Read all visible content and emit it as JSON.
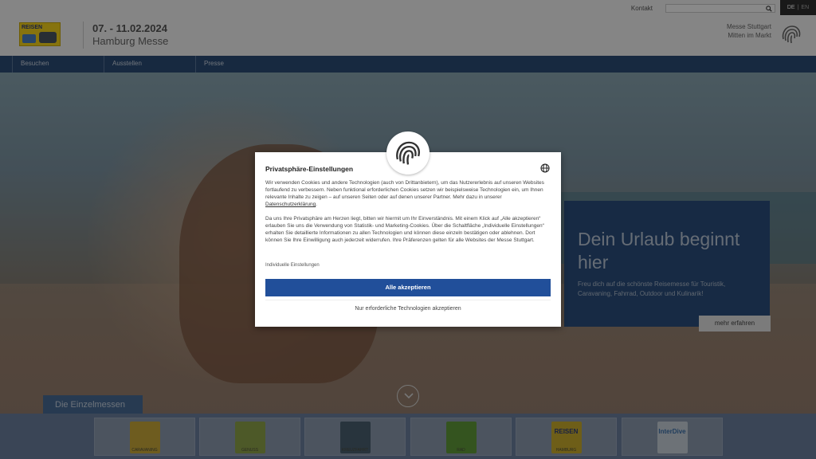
{
  "header": {
    "contact_label": "Kontakt",
    "search_placeholder": "",
    "lang_active": "DE",
    "lang_sep": "|",
    "lang_other": "EN",
    "event_date": "07. - 11.02.2024",
    "event_place": "Hamburg Messe",
    "brand_line1": "Messe Stuttgart",
    "brand_line2": "Mitten im Markt",
    "logo_word": "REISEN"
  },
  "nav": {
    "items": [
      {
        "label": "Besuchen"
      },
      {
        "label": "Ausstellen"
      },
      {
        "label": "Presse"
      }
    ]
  },
  "promo": {
    "title": "Dein Urlaub beginnt hier",
    "text": "Freu dich auf die schönste Reisemesse für Touristik, Caravaning, Fahrrad, Outdoor und Kulinarik!",
    "button": "mehr erfahren"
  },
  "einzelmessen": {
    "tab_label": "Die Einzelmessen",
    "cards": [
      {
        "word": "",
        "label": "CARAVANING",
        "color": "#c8a83a"
      },
      {
        "word": "",
        "label": "GENUSS",
        "color": "#8da34a"
      },
      {
        "word": "",
        "label": "KREUZFAHRT",
        "color": "#4a6070"
      },
      {
        "word": "",
        "label": "RAD",
        "color": "#5f9a3a"
      },
      {
        "word": "REISEN",
        "label": "HAMBURG",
        "color": "#c8ac2c"
      },
      {
        "word": "InterDive",
        "label": "",
        "color": "#c6cfd9"
      }
    ]
  },
  "modal": {
    "title": "Privatsphäre-Einstellungen",
    "p1": "Wir verwenden Cookies und andere Technologien (auch von Drittanbietern), um das Nutzererlebnis auf unseren Websites fortlaufend zu verbessern. Neben funktional erforderlichen Cookies setzen wir beispielsweise Technologien ein, um Ihnen relevante Inhalte zu zeigen – auf unseren Seiten oder auf denen unserer Partner. Mehr dazu in unserer ",
    "p1_link": "Datenschutzerklärung",
    "p1_end": ".",
    "p2": "Da uns Ihre Privatsphäre am Herzen liegt, bitten wir hiermit um Ihr Einverständnis. Mit einem Klick auf „Alle akzeptieren“ erlauben Sie uns die Verwendung von Statistik- und Marketing-Cookies. Über die Schaltfläche „Individuelle Einstellungen“ erhalten Sie detaillierte Informationen zu allen Technologien und können diese einzeln bestätigen oder ablehnen. Dort können Sie Ihre Einwilligung auch jederzeit widerrufen. Ihre Präferenzen gelten für alle Websites der Messe Stuttgart.",
    "individual_link": "Individuelle Einstellungen",
    "accept_all": "Alle akzeptieren",
    "necessary_only": "Nur erforderliche Technologien akzeptieren"
  },
  "colors": {
    "nav": "#2a4c76",
    "accept": "#214f9a",
    "promo": "#2b4e7c"
  }
}
